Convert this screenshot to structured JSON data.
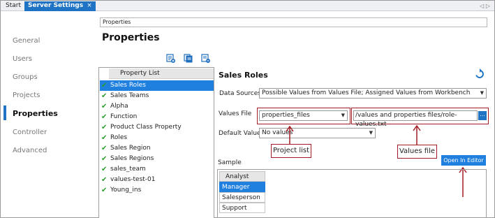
{
  "tabs": [
    {
      "label": "Start"
    },
    {
      "label": "Server Settings",
      "close": "×"
    }
  ],
  "tab_scroll": "◁ ▷",
  "nav": {
    "items": [
      "General",
      "Users",
      "Groups",
      "Projects",
      "Properties",
      "Controller",
      "Advanced"
    ],
    "active": "Properties"
  },
  "breadcrumb": "Properties",
  "page_title": "Properties",
  "property_list": {
    "header": "Property List",
    "items": [
      "Sales Roles",
      "Sales Teams",
      "Alpha",
      "Function",
      "Product Class Property",
      "Roles",
      "Sales Region",
      "Sales Regions",
      "sales_team",
      "values-test-01",
      "Young_ins"
    ],
    "selected": "Sales Roles"
  },
  "detail": {
    "title": "Sales Roles",
    "data_sources_label": "Data Sources",
    "data_sources_value": "Possible Values from Values File; Assigned Values from Workbench",
    "values_file_label": "Values File",
    "project_value": "properties_files",
    "file_path": "/values and properties files/role-values.txt",
    "browse_label": "...",
    "default_values_label": "Default Values",
    "default_values_value": "No values",
    "sample_label": "Sample",
    "open_button": "Open In Editor",
    "sample_items": [
      "Analyst",
      "Manager",
      "Salesperson",
      "Support"
    ],
    "sample_selected": "Manager"
  },
  "callouts": {
    "project_list": "Project list",
    "values_file": "Values file"
  },
  "colors": {
    "accent": "#1f80e0",
    "callout_border": "#a31b23",
    "check": "#2a9d2a"
  }
}
